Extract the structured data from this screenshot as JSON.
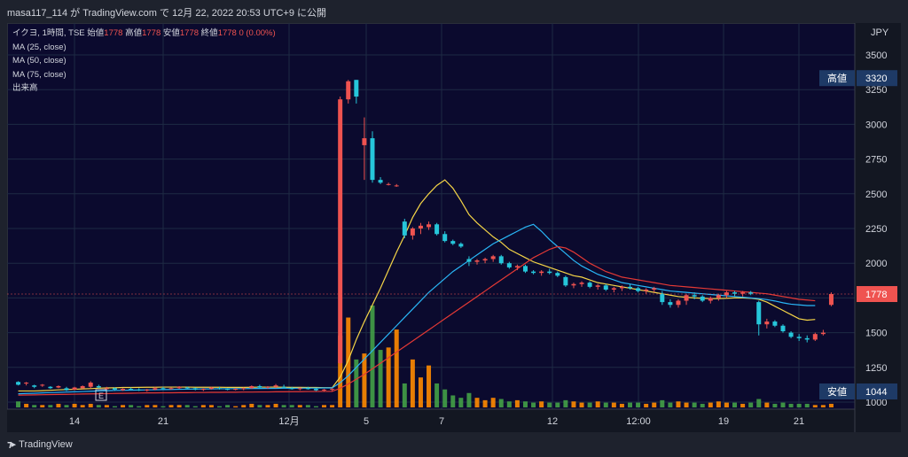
{
  "header": {
    "text": "masa117_114 が TradingView.com で 12月 22, 2022 20:53 UTC+9 に公開"
  },
  "legend": {
    "symbol": "イクヨ, 1時間, TSE",
    "open_label": "始値",
    "open": "1778",
    "high_label": "高値",
    "high": "1778",
    "low_label": "安値",
    "low": "1778",
    "close_label": "終値",
    "close": "1778",
    "change": "0 (0.00%)",
    "ma25": "MA (25, close)",
    "ma50": "MA (50, close)",
    "ma75": "MA (75, close)",
    "volume": "出来高"
  },
  "footer": {
    "brand": "TradingView",
    "logo": "tradingview-logo-icon"
  },
  "colors": {
    "up": "#ef5350",
    "down": "#26c6da",
    "ma25": "#f5d547",
    "ma50": "#29b6f6",
    "ma75": "#e53935",
    "vol_up": "#ff8a00",
    "vol_down": "#43a047",
    "bg": "#0b0a2e",
    "axis_bg": "#131722"
  },
  "chart_data": {
    "type": "candlestick",
    "currency": "JPY",
    "y_ticks": [
      "3500",
      "3250",
      "3000",
      "2750",
      "2500",
      "2250",
      "2000",
      "1750",
      "1500",
      "1250",
      "1000"
    ],
    "ylim": [
      1000,
      3600
    ],
    "x_ticks": [
      "14",
      "21",
      "12月",
      "5",
      "7",
      "12",
      "12:00",
      "19",
      "21"
    ],
    "high_badge": {
      "label": "高値",
      "value": "3320"
    },
    "low_badge": {
      "label": "安値",
      "value": "1044"
    },
    "last_price": "1778",
    "event_marker": "E",
    "candles": [
      [
        1145,
        1150,
        1120,
        1125
      ],
      [
        1135,
        1145,
        1120,
        1140
      ],
      [
        1120,
        1125,
        1100,
        1110
      ],
      [
        1120,
        1130,
        1110,
        1125
      ],
      [
        1110,
        1115,
        1095,
        1100
      ],
      [
        1105,
        1120,
        1100,
        1115
      ],
      [
        1100,
        1110,
        1080,
        1085
      ],
      [
        1090,
        1110,
        1085,
        1105
      ],
      [
        1100,
        1120,
        1095,
        1115
      ],
      [
        1110,
        1150,
        1100,
        1140
      ],
      [
        1115,
        1125,
        1100,
        1105
      ],
      [
        1100,
        1110,
        1090,
        1100
      ],
      [
        1100,
        1105,
        1080,
        1090
      ],
      [
        1085,
        1100,
        1080,
        1095
      ],
      [
        1095,
        1105,
        1085,
        1090
      ],
      [
        1090,
        1100,
        1080,
        1085
      ],
      [
        1085,
        1095,
        1075,
        1090
      ],
      [
        1090,
        1110,
        1085,
        1100
      ],
      [
        1100,
        1110,
        1090,
        1095
      ],
      [
        1095,
        1105,
        1090,
        1100
      ],
      [
        1100,
        1115,
        1095,
        1110
      ],
      [
        1105,
        1110,
        1095,
        1100
      ],
      [
        1100,
        1105,
        1085,
        1090
      ],
      [
        1090,
        1100,
        1080,
        1095
      ],
      [
        1095,
        1110,
        1090,
        1105
      ],
      [
        1100,
        1110,
        1090,
        1095
      ],
      [
        1095,
        1100,
        1085,
        1090
      ],
      [
        1090,
        1100,
        1085,
        1095
      ],
      [
        1095,
        1105,
        1085,
        1100
      ],
      [
        1100,
        1120,
        1095,
        1115
      ],
      [
        1115,
        1125,
        1100,
        1105
      ],
      [
        1105,
        1115,
        1095,
        1110
      ],
      [
        1110,
        1130,
        1100,
        1120
      ],
      [
        1110,
        1125,
        1100,
        1105
      ],
      [
        1100,
        1110,
        1090,
        1095
      ],
      [
        1100,
        1105,
        1085,
        1100
      ],
      [
        1100,
        1110,
        1090,
        1095
      ],
      [
        1095,
        1100,
        1080,
        1085
      ],
      [
        1085,
        1095,
        1075,
        1090
      ],
      [
        1090,
        1100,
        1080,
        1095
      ],
      [
        1280,
        3200,
        1260,
        3180
      ],
      [
        3180,
        3320,
        3150,
        3310
      ],
      [
        3320,
        3320,
        3150,
        3200
      ],
      [
        2850,
        3050,
        2600,
        2900
      ],
      [
        2900,
        2950,
        2580,
        2600
      ],
      [
        2600,
        2620,
        2570,
        2580
      ],
      [
        2570,
        2580,
        2560,
        2570
      ],
      [
        2560,
        2570,
        2550,
        2560
      ],
      [
        2300,
        2320,
        2180,
        2200
      ],
      [
        2200,
        2260,
        2170,
        2250
      ],
      [
        2250,
        2290,
        2210,
        2270
      ],
      [
        2260,
        2300,
        2240,
        2280
      ],
      [
        2280,
        2290,
        2200,
        2210
      ],
      [
        2210,
        2230,
        2150,
        2160
      ],
      [
        2160,
        2170,
        2130,
        2140
      ],
      [
        2140,
        2150,
        2110,
        2120
      ],
      [
        2030,
        2050,
        1980,
        2010
      ],
      [
        2010,
        2030,
        1990,
        2020
      ],
      [
        2020,
        2040,
        2000,
        2030
      ],
      [
        2030,
        2060,
        2010,
        2050
      ],
      [
        2050,
        2060,
        1990,
        2000
      ],
      [
        2000,
        2010,
        1960,
        1970
      ],
      [
        1970,
        1990,
        1950,
        1980
      ],
      [
        1980,
        1990,
        1930,
        1940
      ],
      [
        1940,
        1950,
        1920,
        1930
      ],
      [
        1930,
        1950,
        1910,
        1940
      ],
      [
        1940,
        1960,
        1920,
        1930
      ],
      [
        1930,
        1940,
        1900,
        1910
      ],
      [
        1900,
        1910,
        1830,
        1840
      ],
      [
        1840,
        1860,
        1820,
        1850
      ],
      [
        1850,
        1870,
        1830,
        1860
      ],
      [
        1860,
        1870,
        1820,
        1830
      ],
      [
        1830,
        1850,
        1810,
        1840
      ],
      [
        1840,
        1850,
        1800,
        1810
      ],
      [
        1810,
        1830,
        1790,
        1820
      ],
      [
        1820,
        1840,
        1800,
        1830
      ],
      [
        1830,
        1850,
        1810,
        1820
      ],
      [
        1820,
        1830,
        1790,
        1800
      ],
      [
        1800,
        1820,
        1780,
        1810
      ],
      [
        1810,
        1830,
        1790,
        1820
      ],
      [
        1780,
        1800,
        1700,
        1720
      ],
      [
        1720,
        1740,
        1680,
        1700
      ],
      [
        1700,
        1740,
        1680,
        1730
      ],
      [
        1730,
        1780,
        1700,
        1770
      ],
      [
        1770,
        1790,
        1740,
        1760
      ],
      [
        1760,
        1770,
        1720,
        1730
      ],
      [
        1730,
        1760,
        1710,
        1750
      ],
      [
        1750,
        1780,
        1730,
        1770
      ],
      [
        1770,
        1800,
        1750,
        1790
      ],
      [
        1790,
        1800,
        1760,
        1780
      ],
      [
        1780,
        1800,
        1760,
        1790
      ],
      [
        1790,
        1800,
        1770,
        1780
      ],
      [
        1720,
        1730,
        1480,
        1560
      ],
      [
        1560,
        1600,
        1530,
        1580
      ],
      [
        1580,
        1590,
        1540,
        1550
      ],
      [
        1550,
        1560,
        1500,
        1510
      ],
      [
        1500,
        1510,
        1460,
        1470
      ],
      [
        1470,
        1490,
        1440,
        1460
      ],
      [
        1460,
        1480,
        1430,
        1450
      ],
      [
        1450,
        1500,
        1440,
        1490
      ],
      [
        1490,
        1520,
        1480,
        1500
      ],
      [
        1700,
        1790,
        1690,
        1778
      ]
    ],
    "volume": [
      5,
      3,
      2,
      2,
      2,
      3,
      2,
      3,
      2,
      3,
      2,
      2,
      1,
      2,
      2,
      1,
      2,
      2,
      1,
      2,
      2,
      2,
      1,
      2,
      2,
      1,
      2,
      1,
      2,
      3,
      2,
      2,
      3,
      2,
      2,
      2,
      2,
      1,
      2,
      2,
      60,
      75,
      40,
      45,
      85,
      48,
      50,
      65,
      20,
      40,
      25,
      35,
      20,
      15,
      10,
      8,
      12,
      8,
      6,
      8,
      7,
      5,
      6,
      5,
      4,
      5,
      4,
      4,
      6,
      5,
      4,
      4,
      5,
      4,
      4,
      3,
      4,
      4,
      3,
      4,
      6,
      4,
      5,
      4,
      4,
      3,
      4,
      5,
      4,
      4,
      3,
      4,
      7,
      4,
      3,
      4,
      3,
      3,
      3,
      2,
      2,
      3
    ],
    "ma25": [
      1080,
      1080,
      1080,
      1082,
      1085,
      1088,
      1090,
      1092,
      1095,
      1097,
      1100,
      1102,
      1103,
      1105,
      1105,
      1106,
      1107,
      1107,
      1108,
      1108,
      1108,
      1108,
      1107,
      1107,
      1107,
      1107,
      1106,
      1106,
      1106,
      1107,
      1108,
      1108,
      1108,
      1107,
      1106,
      1106,
      1105,
      1105,
      1104,
      1104,
      1180,
      1300,
      1450,
      1580,
      1700,
      1820,
      1950,
      2080,
      2200,
      2330,
      2430,
      2500,
      2560,
      2600,
      2540,
      2450,
      2350,
      2290,
      2240,
      2190,
      2150,
      2100,
      2070,
      2040,
      2010,
      1990,
      1970,
      1950,
      1930,
      1910,
      1900,
      1880,
      1860,
      1850,
      1840,
      1830,
      1820,
      1810,
      1800,
      1790,
      1780,
      1770,
      1760,
      1755,
      1750,
      1748,
      1745,
      1745,
      1748,
      1750,
      1750,
      1748,
      1740,
      1720,
      1690,
      1660,
      1630,
      1600,
      1590,
      1595
    ],
    "ma50": [
      1060,
      1062,
      1064,
      1066,
      1068,
      1070,
      1072,
      1074,
      1076,
      1078,
      1080,
      1082,
      1084,
      1085,
      1086,
      1087,
      1088,
      1089,
      1090,
      1091,
      1092,
      1093,
      1094,
      1095,
      1095,
      1096,
      1096,
      1097,
      1097,
      1098,
      1098,
      1099,
      1099,
      1100,
      1100,
      1100,
      1101,
      1101,
      1102,
      1102,
      1140,
      1190,
      1250,
      1310,
      1370,
      1430,
      1490,
      1550,
      1610,
      1670,
      1730,
      1790,
      1840,
      1890,
      1940,
      1980,
      2020,
      2060,
      2100,
      2140,
      2170,
      2200,
      2230,
      2260,
      2280,
      2230,
      2170,
      2120,
      2070,
      2020,
      1980,
      1950,
      1920,
      1900,
      1880,
      1860,
      1850,
      1840,
      1830,
      1820,
      1810,
      1800,
      1795,
      1790,
      1785,
      1780,
      1775,
      1770,
      1765,
      1760,
      1755,
      1750,
      1745,
      1738,
      1728,
      1715,
      1705,
      1700,
      1695,
      1695
    ],
    "ma75": [
      1050,
      1051,
      1052,
      1053,
      1054,
      1055,
      1056,
      1057,
      1058,
      1059,
      1060,
      1061,
      1062,
      1063,
      1064,
      1065,
      1066,
      1066,
      1067,
      1067,
      1068,
      1068,
      1069,
      1069,
      1070,
      1070,
      1071,
      1071,
      1072,
      1072,
      1073,
      1073,
      1074,
      1074,
      1075,
      1075,
      1076,
      1076,
      1077,
      1077,
      1100,
      1130,
      1165,
      1200,
      1240,
      1280,
      1320,
      1360,
      1400,
      1440,
      1480,
      1520,
      1560,
      1600,
      1640,
      1680,
      1720,
      1760,
      1800,
      1840,
      1880,
      1920,
      1960,
      2000,
      2040,
      2070,
      2100,
      2120,
      2110,
      2080,
      2040,
      2000,
      1970,
      1940,
      1920,
      1900,
      1890,
      1880,
      1870,
      1860,
      1850,
      1840,
      1835,
      1830,
      1825,
      1820,
      1815,
      1810,
      1805,
      1800,
      1795,
      1790,
      1785,
      1780,
      1770,
      1760,
      1750,
      1740,
      1735,
      1730
    ]
  }
}
